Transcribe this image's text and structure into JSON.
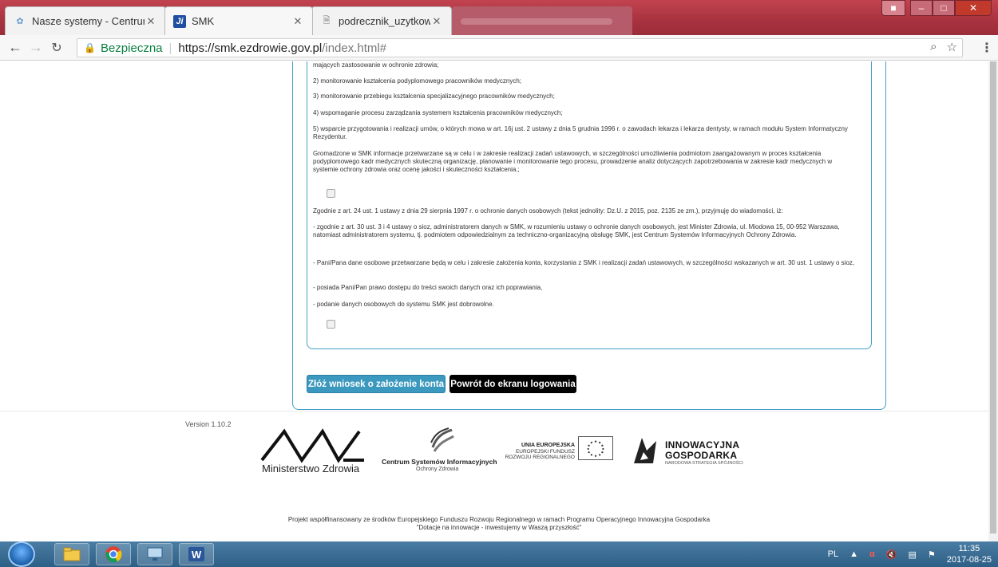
{
  "browser": {
    "tabs": [
      {
        "title": "Nasze systemy - Centrum",
        "active": false,
        "icon": "cez-icon"
      },
      {
        "title": "SMK",
        "active": true,
        "icon": "smk-icon"
      },
      {
        "title": "podrecznik_uzytkownika",
        "active": false,
        "icon": "document-icon"
      }
    ],
    "secure_label": "Bezpieczna",
    "url_host": "https://smk.ezdrowie.gov.pl",
    "url_path": "/index.html#"
  },
  "content": {
    "paragraphs": [
      "mających zastosowanie w ochronie zdrowia;",
      "2) monitorowanie kształcenia podyplomowego pracowników medycznych;",
      "3) monitorowanie przebiegu kształcenia specjalizacyjnego pracowników medycznych;",
      "4) wspomaganie procesu zarządzania systemem kształcenia pracowników medycznych;",
      "5) wsparcie przygotowania i realizacji umów, o których mowa w art. 16j ust. 2 ustawy z dnia 5 grudnia 1996 r. o zawodach lekarza i lekarza dentysty, w ramach modułu System Informatyczny Rezydentur.",
      "Gromadzone w SMK informacje przetwarzane są w celu i w zakresie realizacji zadań ustawowych, w szczególności umożliwienia podmiotom zaangażowanym w proces kształcenia podyplomowego kadr medycznych skuteczną organizację, planowanie i monitorowanie tego procesu, prowadzenie analiz dotyczących zapotrzebowania w zakresie kadr medycznych w systemie ochrony zdrowia oraz ocenę jakości i skuteczności kształcenia.;",
      "Zgodnie z art. 24 ust. 1 ustawy z dnia 29 sierpnia 1997 r. o ochronie danych osobowych (tekst jednolity: Dz.U. z 2015, poz. 2135 ze zm.), przyjmuję do wiadomości, iż:",
      "- zgodnie z art. 30 ust. 3 i 4 ustawy o sioz, administratorem danych w SMK, w rozumieniu ustawy o ochronie danych osobowych, jest Minister Zdrowia, ul. Miodowa 15, 00-952 Warszawa, natomiast administratorem systemu, tj. podmiotem odpowiedzialnym za techniczno-organizacyjną obsługę SMK, jest Centrum Systemów Informacyjnych Ochrony Zdrowia.",
      "- Pani/Pana dane osobowe przetwarzane będą w celu i zakresie założenia konta, korzystania z SMK i realizacji zadań ustawowych, w szczególności wskazanych w art. 30 ust. 1 ustawy o sioz,",
      "- posiada Pani/Pan prawo dostępu do treści swoich danych oraz ich poprawiania,",
      "- podanie danych osobowych do systemu SMK jest dobrowolne."
    ],
    "submit_label": "Złóż wniosek o założenie konta",
    "back_label": "Powrót do ekranu logowania"
  },
  "footer": {
    "version": "Version 1.10.2",
    "moz_label": "Ministerstwo Zdrowia",
    "csioz_main": "Centrum Systemów Informacyjnych",
    "csioz_sub": "Ochrony Zdrowia",
    "ue_line1": "UNIA EUROPEJSKA",
    "ue_line2": "EUROPEJSKI FUNDUSZ",
    "ue_line3": "ROZWOJU REGIONALNEGO",
    "ig_line1": "INNOWACYJNA",
    "ig_line2": "GOSPODARKA",
    "ig_sub": "NARODOWA STRATEGIA SPÓJNOŚCI",
    "funding_line1": "Projekt współfinansowany ze środków Europejskiego Funduszu Rozwoju Regionalnego w ramach Programu Operacyjnego Innowacyjna Gospodarka",
    "funding_line2": "\"Dotacje na innowacje - inwestujemy w Waszą przyszłość\""
  },
  "taskbar": {
    "language": "PL",
    "time": "11:35",
    "date": "2017-08-25",
    "apps": [
      "explorer-icon",
      "chrome-icon",
      "remote-desktop-icon",
      "word-icon"
    ]
  },
  "colors": {
    "accent": "#3b98be",
    "card_border": "#43a0c4",
    "chrome_frame": "#a8323f"
  }
}
